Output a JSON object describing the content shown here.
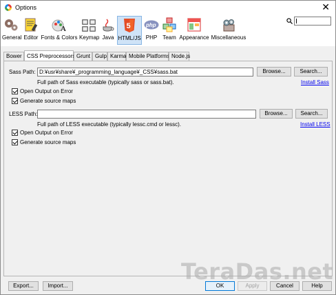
{
  "window": {
    "title": "Options"
  },
  "toolbar": {
    "categories": [
      {
        "label": "General",
        "icon": "gears-icon"
      },
      {
        "label": "Editor",
        "icon": "editor-icon"
      },
      {
        "label": "Fonts & Colors",
        "icon": "fonts-colors-icon"
      },
      {
        "label": "Keymap",
        "icon": "keyboard-icon"
      },
      {
        "label": "Java",
        "icon": "java-cup-icon"
      },
      {
        "label": "HTML/JS",
        "icon": "html5-icon",
        "active": true
      },
      {
        "label": "PHP",
        "icon": "php-icon"
      },
      {
        "label": "Team",
        "icon": "team-icon"
      },
      {
        "label": "Appearance",
        "icon": "appearance-icon"
      },
      {
        "label": "Miscellaneous",
        "icon": "miscellaneous-icon"
      }
    ],
    "search_value": ""
  },
  "tabs": [
    "Bower",
    "CSS Preprocessors",
    "Grunt",
    "Gulp",
    "Karma",
    "Mobile Platforms",
    "Node.js"
  ],
  "active_tab": "CSS Preprocessors",
  "sass": {
    "path_label": "Sass Path:",
    "path_value": "D:¥usr¥share¥_programming_language¥_CSS¥sass.bat",
    "browse": "Browse...",
    "search": "Search...",
    "hint": "Full path of Sass executable (typically sass or sass.bat).",
    "install_link": "Install Sass",
    "open_output": "Open Output on Error",
    "open_output_checked": true,
    "source_maps": "Generate source maps",
    "source_maps_checked": true
  },
  "less": {
    "path_label": "LESS Path:",
    "path_value": "",
    "browse": "Browse...",
    "search": "Search...",
    "hint": "Full path of LESS executable (typically lessc.cmd or lessc).",
    "install_link": "Install LESS",
    "open_output": "Open Output on Error",
    "open_output_checked": true,
    "source_maps": "Generate source maps",
    "source_maps_checked": true
  },
  "footer": {
    "export": "Export...",
    "import": "Import...",
    "ok": "OK",
    "apply": "Apply",
    "cancel": "Cancel",
    "help": "Help"
  },
  "watermark": "TeraDas.net",
  "colors": {
    "active_tab_bg": "#cfe3f7",
    "link": "#0000ee",
    "primary_border": "#0078d7"
  }
}
